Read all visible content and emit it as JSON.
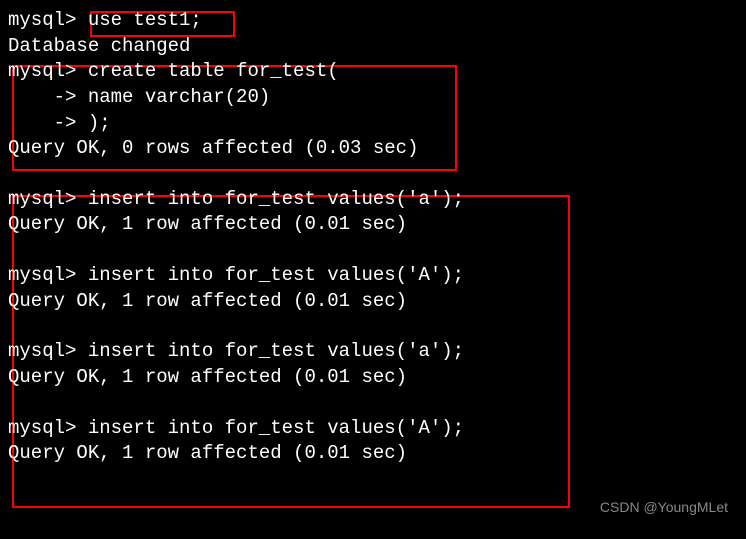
{
  "terminal": {
    "lines": [
      "mysql> use test1;",
      "Database changed",
      "mysql> create table for_test(",
      "    -> name varchar(20)",
      "    -> );",
      "Query OK, 0 rows affected (0.03 sec)",
      "",
      "mysql> insert into for_test values('a');",
      "Query OK, 1 row affected (0.01 sec)",
      "",
      "mysql> insert into for_test values('A');",
      "Query OK, 1 row affected (0.01 sec)",
      "",
      "mysql> insert into for_test values('a');",
      "Query OK, 1 row affected (0.01 sec)",
      "",
      "mysql> insert into for_test values('A');",
      "Query OK, 1 row affected (0.01 sec)"
    ]
  },
  "watermark": "CSDN @YoungMLet"
}
